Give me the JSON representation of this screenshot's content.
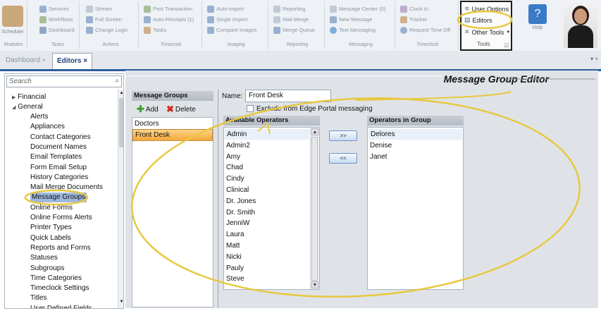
{
  "ribbon": {
    "groups": [
      {
        "label": "Modules",
        "big": "Scheduler",
        "items": []
      },
      {
        "label": "Tasks",
        "items": [
          "Services",
          "Workflows",
          "Dashboard"
        ]
      },
      {
        "label": "Actions",
        "items": [
          "Stream",
          "Full Screen",
          "Change Login"
        ]
      },
      {
        "label": "Financial",
        "items": [
          "Post Transaction",
          "Auto-Receipts (1)",
          "Tasks"
        ]
      },
      {
        "label": "Imaging",
        "items": [
          "Auto-Import",
          "Single Import",
          "Compare Images"
        ]
      },
      {
        "label": "Reporting",
        "items": [
          "Reporting",
          "Mail Merge",
          "Merge Queue"
        ]
      },
      {
        "label": "Messaging",
        "items": [
          "Message Center (0)",
          "New Message",
          "Text Messaging"
        ]
      },
      {
        "label": "Timeclock",
        "items": [
          "Clock In",
          "Tracker",
          "Request Time Off"
        ]
      }
    ],
    "tools": {
      "user_options": "User Options",
      "editors": "Editors",
      "other_tools": "Other Tools",
      "label": "Tools"
    },
    "help": {
      "label": "Help"
    }
  },
  "tabs": {
    "dashboard": "Dashboard",
    "editors": "Editors",
    "editors_close": "×"
  },
  "sidebar": {
    "search_placeholder": "Search",
    "items": [
      "Financial",
      "General",
      "Alerts",
      "Appliances",
      "Contact Categories",
      "Document Names",
      "Email Templates",
      "Form Email Setup",
      "History Categories",
      "Mail Merge Documents",
      "Message Groups",
      "Online Forms",
      "Online Forms Alerts",
      "Printer Types",
      "Quick Labels",
      "Reports and Forms",
      "Statuses",
      "Subgroups",
      "Time Categories",
      "Timeclock Settings",
      "Titles",
      "User Defined Fields"
    ]
  },
  "editor": {
    "title": "Message Group Editor",
    "groups_header": "Message Groups",
    "add_label": "Add",
    "delete_label": "Delete",
    "groups": [
      "Doctors",
      "Front Desk"
    ],
    "name_label": "Name:",
    "name_value": "Front Desk",
    "exclude_label": "Exclude from Edge Portal messaging",
    "available_header": "Available Operators",
    "available": [
      "Admin",
      "Admin2",
      "Amy",
      "Chad",
      "Cindy",
      "Clinical",
      "Dr. Jones",
      "Dr. Smith",
      "JenniW",
      "Laura",
      "Matt",
      "Nicki",
      "Pauly",
      "Steve"
    ],
    "add_arrow": ">>",
    "remove_arrow": "<<",
    "ingroup_header": "Operators in Group",
    "ingroup": [
      "Delores",
      "Denise",
      "Janet"
    ]
  },
  "colors": {
    "highlight": "#f7b54a",
    "annotation": "#e8c840",
    "accent": "#2f5e9e"
  }
}
